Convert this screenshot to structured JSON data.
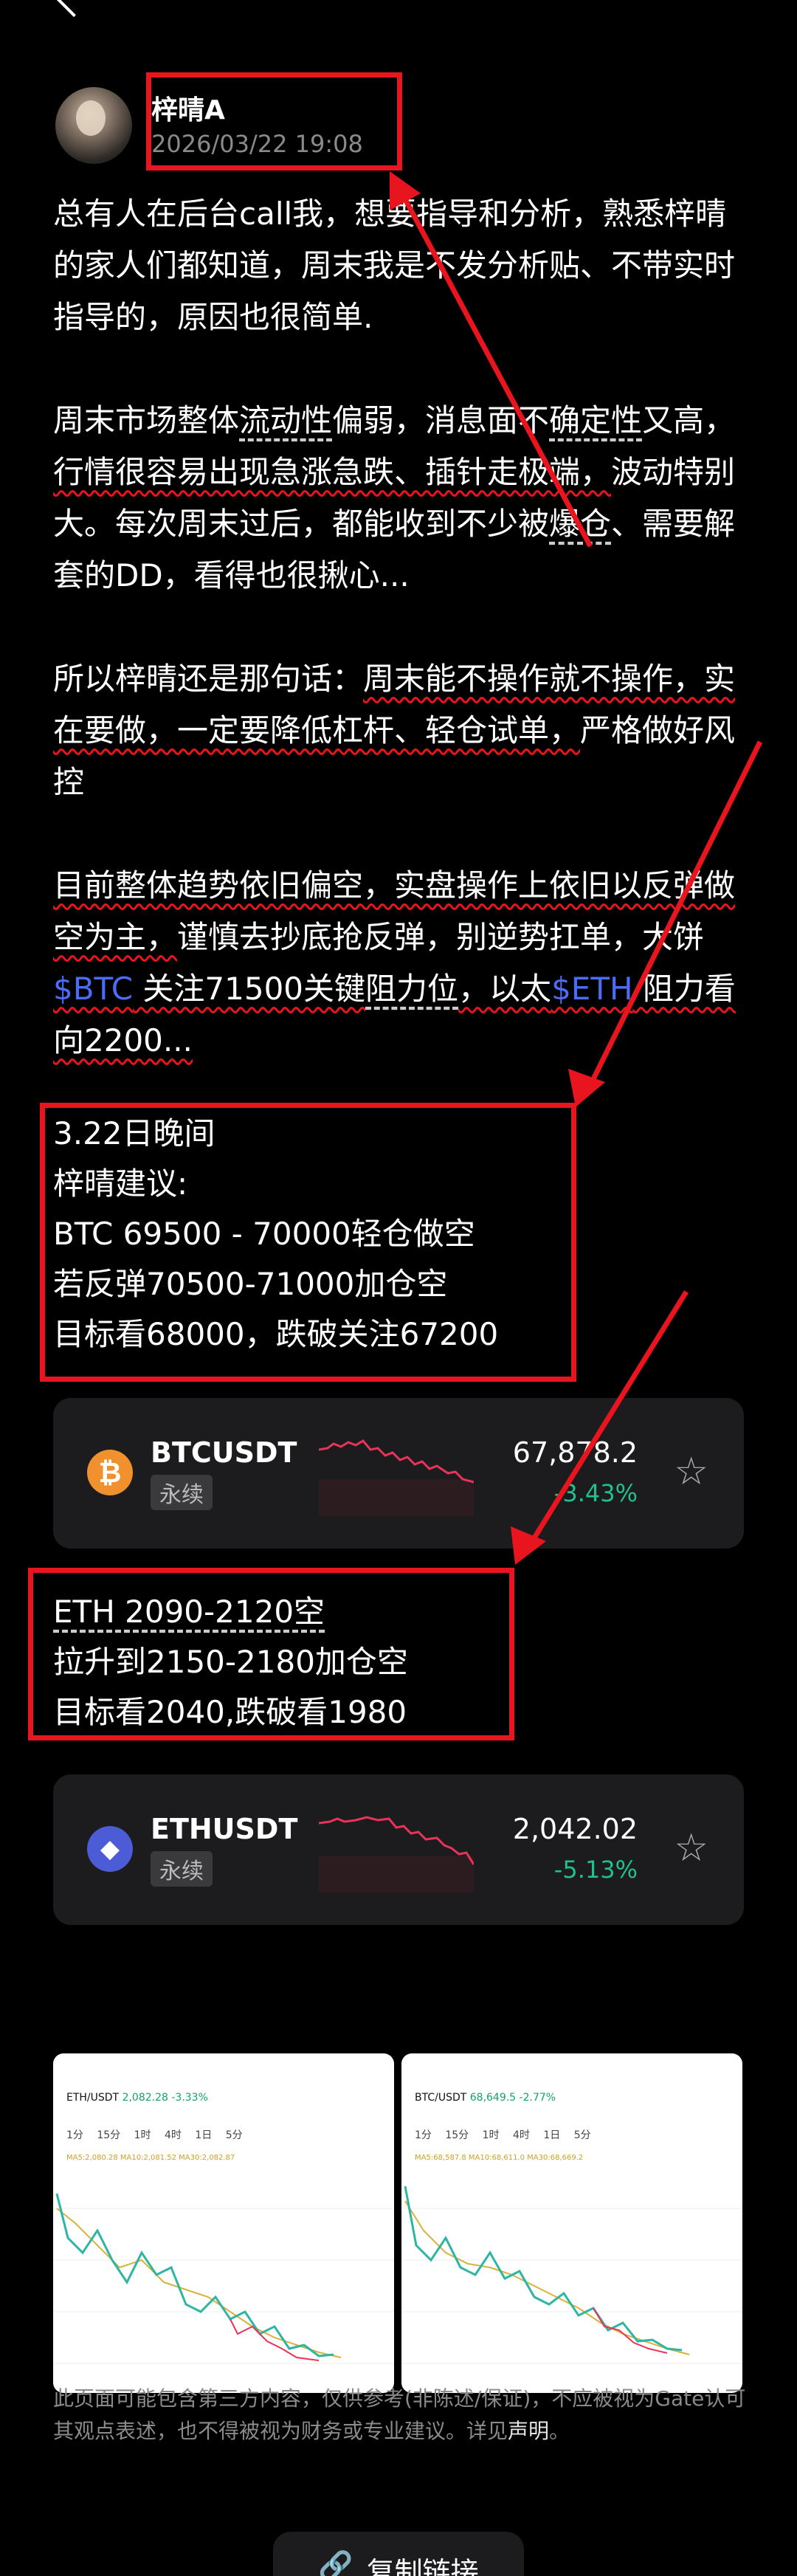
{
  "post": {
    "author": "梓晴A",
    "date": "2026/03/22 19:08",
    "p1": "总有人在后台call我，想要指导和分析，熟悉梓晴的家人们都知道，周末我是不发分析贴、不带实时指导的，原因也很简单.",
    "p2": {
      "a": "周末市场整体",
      "b": "流动性",
      "c": "偏弱，消息面不",
      "d": "确定性",
      "e": "又高，",
      "f": "行情很容易出现急涨急跌、插针走极端，",
      "g": "波动特别大。每次周末过后，都能收到不少被",
      "h": "爆仓",
      "i": "、需要解套的DD，看得也很揪心..."
    },
    "p3": {
      "a": "所以梓晴还是那句话：",
      "b": "周末能不操作就不操作，实在要做，一定要降低杠杆、轻仓试单，",
      "c": "严格做好风控"
    },
    "p4": {
      "a": "目前整体趋势依旧偏空，实盘操作上依旧以反弹做空为主，",
      "b": "谨慎去抄底抢反弹，别逆势扛单，大饼",
      "btc": "$BTC",
      "c": " 关注71500关键",
      "d": "阻力位",
      "e": "，以太",
      "eth": "$ETH",
      "f": " 阻力看向2200..."
    }
  },
  "btc_signal": [
    "3.22日晚间",
    "梓晴建议:",
    "BTC  69500 - 70000轻仓做空",
    "若反弹70500-71000加仓空",
    "目标看68000，跌破关注67200"
  ],
  "eth_signal": [
    "ETH  2090-2120空",
    "拉升到2150-2180加仓空",
    "目标看2040,跌破看1980"
  ],
  "cards": [
    {
      "symbol": "BTCUSDT",
      "tag": "永续",
      "price": "67,878.2",
      "change": "-3.43%",
      "coin": "₿",
      "icon": "bitcoin-icon"
    },
    {
      "symbol": "ETHUSDT",
      "tag": "永续",
      "price": "2,042.02",
      "change": "-5.13%",
      "coin": "◆",
      "icon": "ethereum-icon"
    }
  ],
  "screenshots": [
    {
      "pair": "ETH/USDT",
      "price": "2,082.28",
      "change": "-3.33%",
      "tabs": "1分 15分 1时 4时 1日 5分",
      "ma": "MA5:2,080.28 MA10:2,081.52 MA30:2,082.87"
    },
    {
      "pair": "BTC/USDT",
      "price": "68,649.5",
      "change": "-2.77%",
      "tabs": "1分 15分 1时 4时 1日 5分",
      "ma": "MA5:68,587.8 MA10:68,611.0 MA30:68,669.2"
    }
  ],
  "disclaimer": {
    "text": "此页面可能包含第三方内容，仅供参考(非陈述/保证)，不应被视为Gate认可其观点表述，也不得被视为财务或专业建议。详见",
    "link": "声明",
    "end": "。"
  },
  "copy_button": "复制链接",
  "colors": {
    "annotation_red": "#e8141e",
    "up_green": "#22c08a",
    "ticker_blue": "#4a6cf7"
  }
}
